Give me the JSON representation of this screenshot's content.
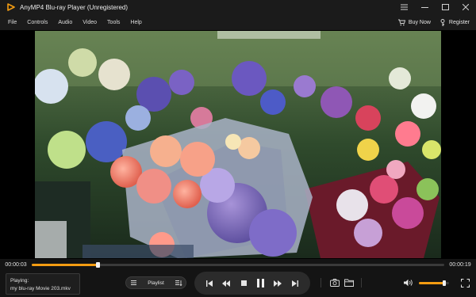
{
  "window": {
    "title": "AnyMP4 Blu-ray Player (Unregistered)",
    "logo_icon": "play-triangle-logo",
    "accent_color": "#f39c12"
  },
  "menu": {
    "items": [
      "File",
      "Controls",
      "Audio",
      "Video",
      "Tools",
      "Help"
    ],
    "buy_now": "Buy Now",
    "register": "Register"
  },
  "player": {
    "elapsed": "00:00:03",
    "duration": "00:00:19",
    "progress_fraction": 0.16,
    "playing_label": "Playing:",
    "file_name": "my blu-ray Movie 203.mkv",
    "playlist_label": "Playlist",
    "volume_fraction": 0.85
  }
}
